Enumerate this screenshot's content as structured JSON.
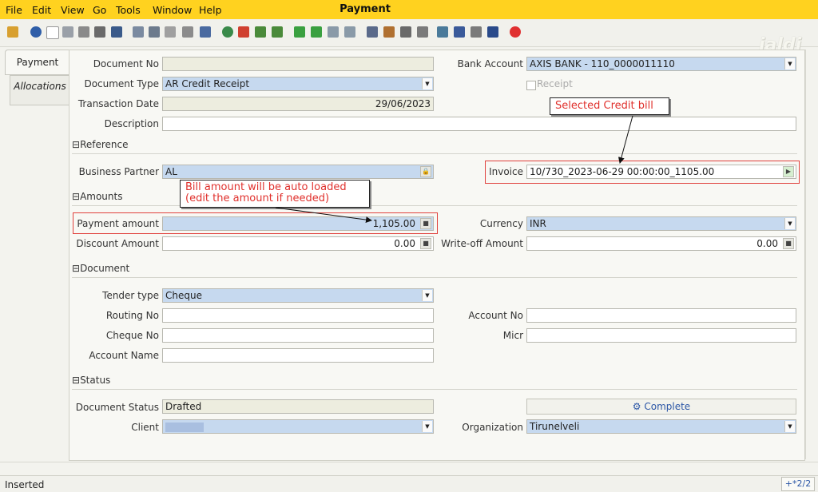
{
  "menu": {
    "file": "File",
    "edit": "Edit",
    "view": "View",
    "go": "Go",
    "tools": "Tools",
    "window": "Window",
    "help": "Help"
  },
  "window_title": "Payment",
  "logo_text": "jaldi",
  "tabs": {
    "payment": "Payment",
    "allocations": "Allocations"
  },
  "form": {
    "document_no": {
      "label": "Document No",
      "value": ""
    },
    "bank_account": {
      "label": "Bank Account",
      "value": "AXIS BANK - 110_0000011110"
    },
    "document_type": {
      "label": "Document Type",
      "value": "AR Credit Receipt"
    },
    "receipt": {
      "label": "Receipt",
      "checked": false
    },
    "transaction_date": {
      "label": "Transaction Date",
      "value": "29/06/2023"
    },
    "description": {
      "label": "Description",
      "value": ""
    },
    "sections": {
      "reference": "Reference",
      "amounts": "Amounts",
      "document": "Document",
      "status": "Status"
    },
    "business_partner": {
      "label": "Business Partner",
      "value": "AL"
    },
    "invoice": {
      "label": "Invoice",
      "value": "10/730_2023-06-29 00:00:00_1105.00"
    },
    "payment_amount": {
      "label": "Payment amount",
      "value": "1,105.00"
    },
    "currency": {
      "label": "Currency",
      "value": "INR"
    },
    "discount_amount": {
      "label": "Discount Amount",
      "value": "0.00"
    },
    "writeoff_amount": {
      "label": "Write-off Amount",
      "value": "0.00"
    },
    "tender_type": {
      "label": "Tender type",
      "value": "Cheque"
    },
    "routing_no": {
      "label": "Routing No",
      "value": ""
    },
    "account_no": {
      "label": "Account No",
      "value": ""
    },
    "cheque_no": {
      "label": "Cheque No",
      "value": ""
    },
    "micr": {
      "label": "Micr",
      "value": ""
    },
    "account_name": {
      "label": "Account Name",
      "value": ""
    },
    "document_status": {
      "label": "Document Status",
      "value": "Drafted"
    },
    "complete_button": "Complete",
    "client": {
      "label": "Client",
      "value": ""
    },
    "organization": {
      "label": "Organization",
      "value": "Tirunelveli"
    }
  },
  "annotations": {
    "selected_credit_bill": "Selected Credit bill",
    "bill_amount_line1": "Bill amount will be auto loaded",
    "bill_amount_line2": "(edit the amount if needed)"
  },
  "status_bar": {
    "text": "Inserted",
    "record_count": "+*2/2"
  },
  "colors": {
    "menubar": "#ffd21f",
    "blue_field": "#c6d9ef",
    "annotation_red": "#e0302c"
  }
}
